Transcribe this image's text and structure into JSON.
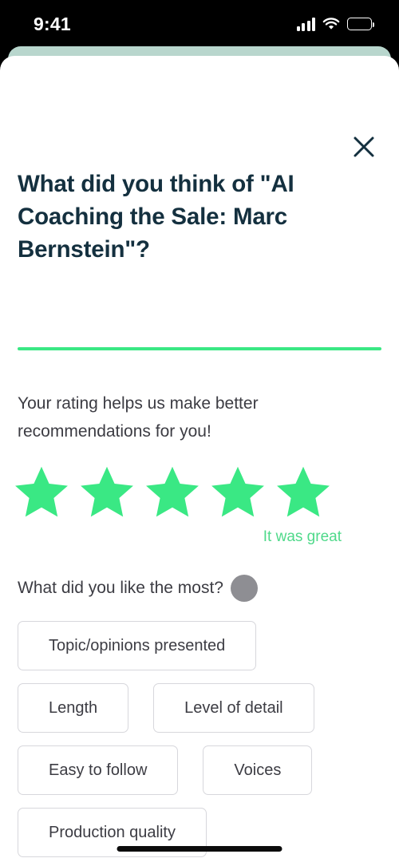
{
  "status_bar": {
    "time": "9:41",
    "signal_icon": "cellular-signal-icon",
    "wifi_icon": "wifi-icon",
    "battery_icon": "battery-icon"
  },
  "sheet": {
    "close_icon": "close-icon",
    "title": "What did you think of \"AI Coaching the Sale: Marc Bernstein\"?",
    "divider_color": "#3ae884",
    "subtitle": "Your rating helps us make better recommendations for you!",
    "rating": {
      "value": 5,
      "max": 5,
      "star_icon": "star-icon",
      "filled_color": "#3ae884",
      "label": "It was great",
      "label_color": "#4fd98a"
    },
    "question": {
      "text": "What did you like the most?",
      "loading_indicator": "loading-circle-icon"
    },
    "chips": [
      {
        "label": "Topic/opinions presented"
      },
      {
        "label": "Length"
      },
      {
        "label": "Level of detail"
      },
      {
        "label": "Easy to follow"
      },
      {
        "label": "Voices"
      },
      {
        "label": "Production quality"
      }
    ]
  },
  "home_indicator": "home-indicator"
}
